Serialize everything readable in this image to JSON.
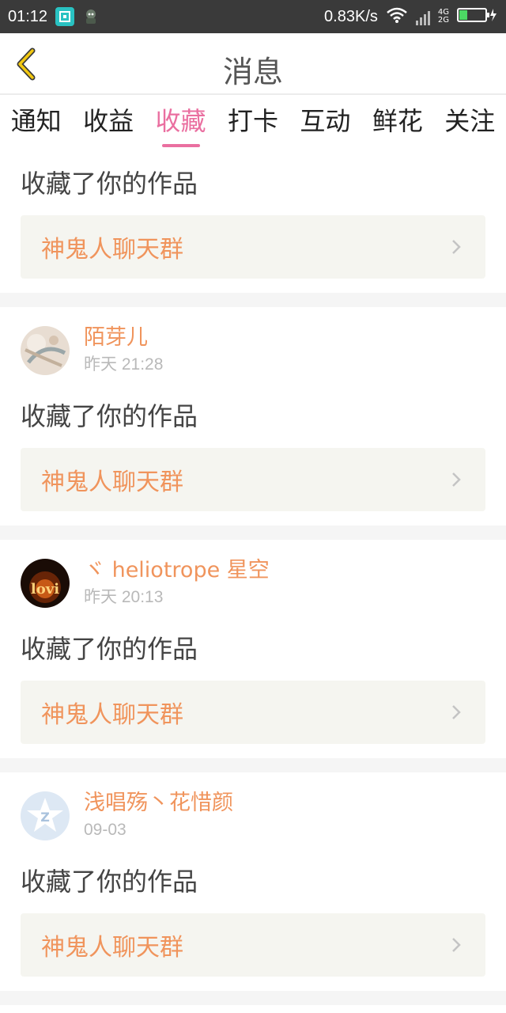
{
  "status_bar": {
    "time": "01:12",
    "net_speed": "0.83K/s",
    "net_4g": "4G",
    "net_2g": "2G"
  },
  "header": {
    "title": "消息"
  },
  "tabs": [
    {
      "label": "通知",
      "active": false
    },
    {
      "label": "收益",
      "active": false
    },
    {
      "label": "收藏",
      "active": true
    },
    {
      "label": "打卡",
      "active": false
    },
    {
      "label": "互动",
      "active": false
    },
    {
      "label": "鲜花",
      "active": false
    },
    {
      "label": "关注",
      "active": false
    }
  ],
  "colors": {
    "accent": "#ea6fa0",
    "orange": "#f0945c"
  },
  "items": [
    {
      "action": "收藏了你的作品",
      "work": "神鬼人聊天群"
    },
    {
      "username": "陌芽儿",
      "time": "昨天 21:28",
      "action": "收藏了你的作品",
      "work": "神鬼人聊天群"
    },
    {
      "username": "ヾ heliotrope 星空",
      "time": "昨天 20:13",
      "action": "收藏了你的作品",
      "work": "神鬼人聊天群"
    },
    {
      "username": "浅唱殇丶花惜颜",
      "time": "09-03",
      "action": "收藏了你的作品",
      "work": "神鬼人聊天群"
    }
  ]
}
